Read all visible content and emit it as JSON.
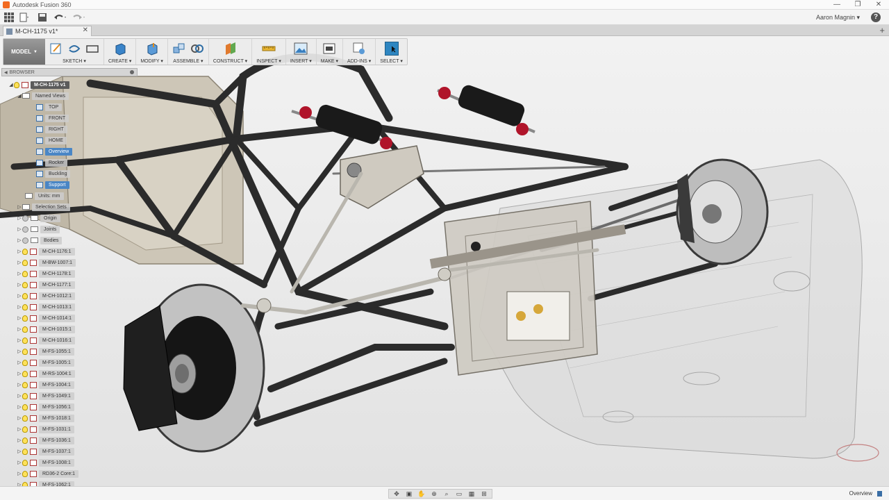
{
  "app": {
    "title": "Autodesk Fusion 360",
    "window_controls": [
      "—",
      "❐",
      "✕"
    ]
  },
  "quick_access": {
    "user": "Aaron Magnin ▾",
    "help": "?"
  },
  "document": {
    "tab_title": "M-CH-1175 v1*",
    "close": "✕",
    "add": "+"
  },
  "toolbar": {
    "workspace": "MODEL",
    "groups": [
      {
        "label": "SKETCH ▾"
      },
      {
        "label": "CREATE ▾"
      },
      {
        "label": "MODIFY ▾"
      },
      {
        "label": "ASSEMBLE ▾"
      },
      {
        "label": "CONSTRUCT ▾"
      },
      {
        "label": "INSPECT ▾"
      },
      {
        "label": "INSERT ▾"
      },
      {
        "label": "MAKE ▾"
      },
      {
        "label": "ADD-INS ▾"
      },
      {
        "label": "SELECT ▾"
      }
    ]
  },
  "browser": {
    "header": "BROWSER",
    "items": [
      {
        "label": "M-CH-1175 v1"
      },
      {
        "label": "Named Views"
      },
      {
        "label": "TOP"
      },
      {
        "label": "FRONT"
      },
      {
        "label": "RIGHT"
      },
      {
        "label": "HOME"
      },
      {
        "label": "Overview"
      },
      {
        "label": "Rocker"
      },
      {
        "label": "Buckling"
      },
      {
        "label": "Support"
      },
      {
        "label": "Units: mm"
      },
      {
        "label": "Selection Sets"
      },
      {
        "label": "Origin"
      },
      {
        "label": "Joints"
      },
      {
        "label": "Bodies"
      },
      {
        "label": "M-CH-1176:1"
      },
      {
        "label": "M-BW-1007:1"
      },
      {
        "label": "M-CH-1178:1"
      },
      {
        "label": "M-CH-1177:1"
      },
      {
        "label": "M-CH-1012:1"
      },
      {
        "label": "M-CH-1013:1"
      },
      {
        "label": "M-CH-1014:1"
      },
      {
        "label": "M-CH-1015:1"
      },
      {
        "label": "M-CH-1016:1"
      },
      {
        "label": "M-FS-1055:1"
      },
      {
        "label": "M-FS-1005:1"
      },
      {
        "label": "M-RS-1004:1"
      },
      {
        "label": "M-FS-1004:1"
      },
      {
        "label": "M-FS-1049:1"
      },
      {
        "label": "M-FS-1056:1"
      },
      {
        "label": "M-FS-1018:1"
      },
      {
        "label": "M-FS-1031:1"
      },
      {
        "label": "M-FS-1036:1"
      },
      {
        "label": "M-FS-1037:1"
      },
      {
        "label": "M-FS-1008:1"
      },
      {
        "label": "RD36-2 Core:1"
      },
      {
        "label": "M-FS-1062:1"
      }
    ]
  },
  "statusbar": {
    "current_view": "Overview"
  },
  "colors": {
    "tube": "#2b2b2b",
    "spring": "#1a1a1a",
    "spring_accent": "#b0142a",
    "bracket": "#c9c4b8",
    "panel": "#c8bfae",
    "rotor": "#bdbdbd",
    "caliper": "#1f1f1f",
    "selection": "#4a86c5"
  }
}
